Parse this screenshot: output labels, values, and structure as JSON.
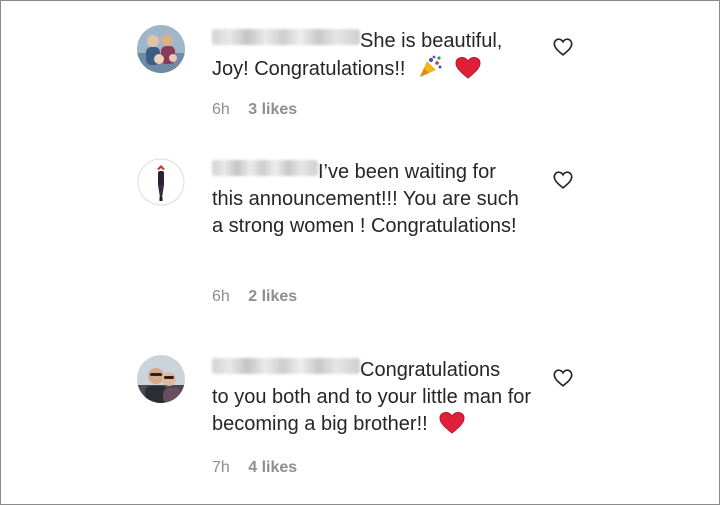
{
  "comments": [
    {
      "text_line1": "She is beautiful,",
      "text_rest": "Joy! Congratulations!!",
      "emojis": [
        "party-popper",
        "red-heart"
      ],
      "time": "6h",
      "likes": "3 likes"
    },
    {
      "text_line1": "I’ve been waiting for",
      "text_rest": "this announcement!!! You are such a strong women ! Congratulations!",
      "emojis": [],
      "time": "6h",
      "likes": "2 likes"
    },
    {
      "text_line1": "Congratulations",
      "text_rest": "to you both and to your little man for becoming a big brother!!",
      "emojis": [
        "red-heart"
      ],
      "time": "7h",
      "likes": "4 likes"
    }
  ],
  "colors": {
    "text": "#262626",
    "meta": "#8e8e8e",
    "heart": "#e0203a",
    "border": "#8a8a8a"
  },
  "icons": {
    "like": "heart-outline-icon",
    "party": "party-popper-icon",
    "love": "red-heart-icon"
  }
}
